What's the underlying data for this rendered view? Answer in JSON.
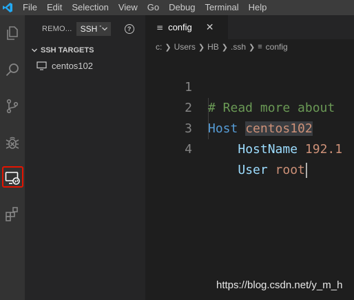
{
  "menubar": {
    "logo_icon": "vscode-logo-icon",
    "items": [
      "File",
      "Edit",
      "Selection",
      "View",
      "Go",
      "Debug",
      "Terminal",
      "Help"
    ]
  },
  "activitybar": {
    "items": [
      {
        "icon": "files-icon"
      },
      {
        "icon": "search-icon"
      },
      {
        "icon": "source-control-icon"
      },
      {
        "icon": "debug-icon"
      },
      {
        "icon": "remote-explorer-icon",
        "highlighted": true
      },
      {
        "icon": "extensions-icon"
      }
    ],
    "highlight_color": "#e51400"
  },
  "sidebar": {
    "title": "REMO...",
    "select_value": "SSH T",
    "help_icon": "help-icon",
    "section": "SSH TARGETS",
    "targets": [
      "centos102"
    ]
  },
  "editor": {
    "tab_label": "config",
    "breadcrumb": [
      "c:",
      "Users",
      "HB",
      ".ssh",
      "config"
    ],
    "lines": [
      {
        "num": "1",
        "parts": [
          {
            "t": "# Read more about",
            "c": "comment"
          }
        ]
      },
      {
        "num": "2",
        "parts": [
          {
            "t": "Host ",
            "c": "key"
          },
          {
            "t": "centos102",
            "c": "val-hl"
          }
        ]
      },
      {
        "num": "3",
        "parts": [
          {
            "t": "    ",
            "c": "plain"
          },
          {
            "t": "HostName ",
            "c": "key2"
          },
          {
            "t": "192.1",
            "c": "val"
          }
        ]
      },
      {
        "num": "4",
        "parts": [
          {
            "t": "    ",
            "c": "plain"
          },
          {
            "t": "User ",
            "c": "key2"
          },
          {
            "t": "root",
            "c": "val"
          }
        ]
      }
    ]
  },
  "watermark": "https://blog.csdn.net/y_m_h",
  "colors": {
    "accent": "#007acc",
    "comment": "#6a9955",
    "keyword": "#569cd6",
    "string": "#ce9178"
  }
}
